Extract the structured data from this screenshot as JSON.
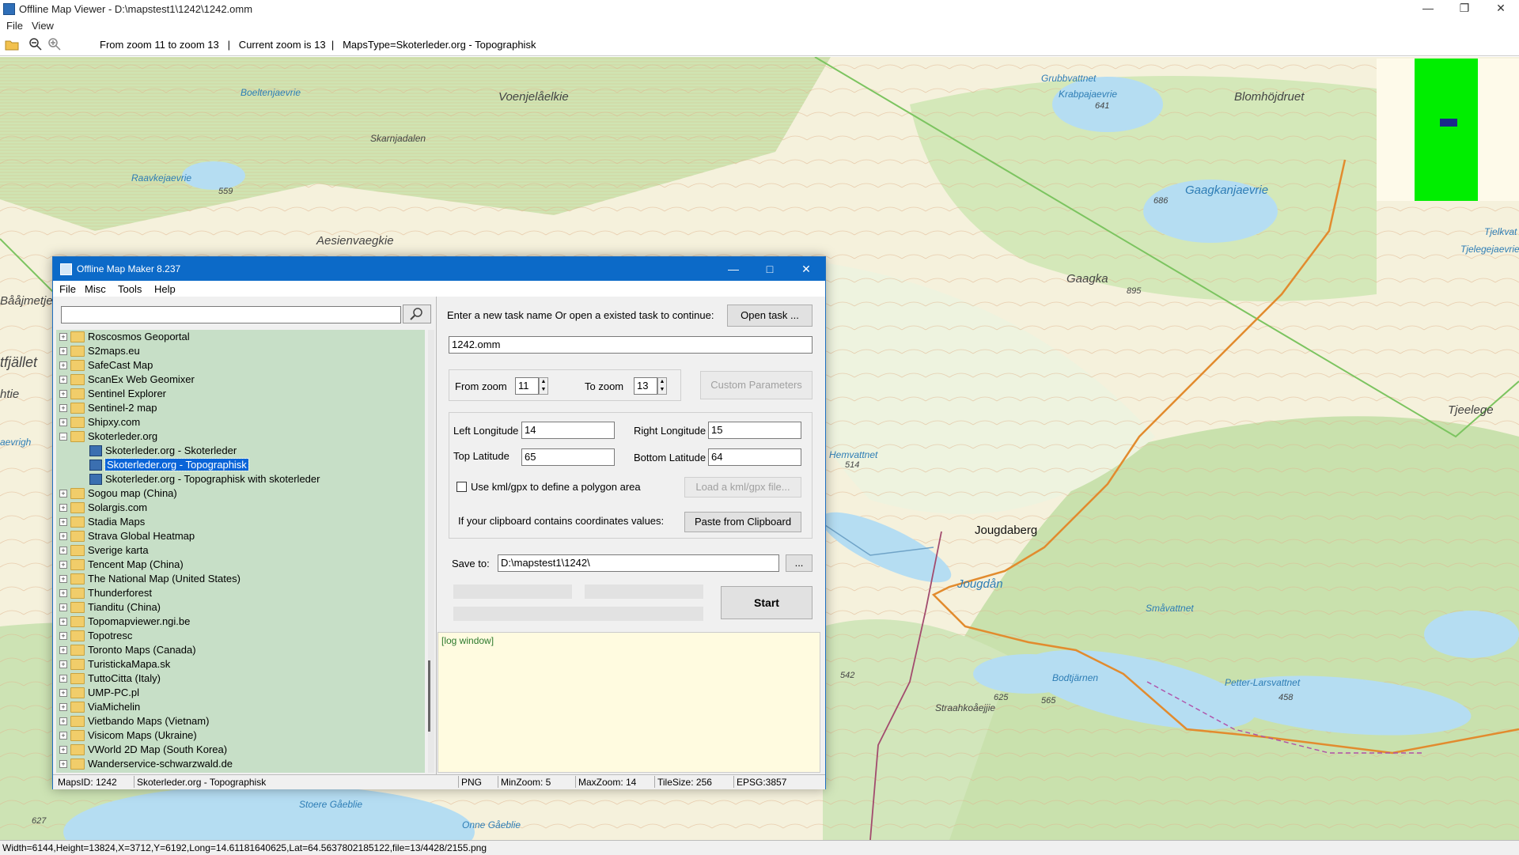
{
  "window": {
    "title": "Offline Map Viewer - D:\\mapstest1\\1242\\1242.omm",
    "menu": [
      "File",
      "View"
    ],
    "toolbar_info": "From zoom 11 to zoom 13   |   Current zoom is 13  |   MapsType=Skoterleder.org - Topographisk"
  },
  "map": {
    "labels": [
      "Voenjelåelkie",
      "Skarnjadalen",
      "Boeltenjaevrie",
      "Raavkejaevrie",
      "559",
      "Aesienvaegkie",
      "Bååjmetje",
      "tfjället",
      "htie",
      "aevrigh",
      "Grubbvattnet",
      "Krabpajaevrie",
      "641",
      "Blomhöjdruet",
      "Gaagkanjaevrie",
      "686",
      "Gaagka",
      "895",
      "Tjelkvat",
      "Tjelegejaevrie",
      "Tjeelege",
      "Hemvattnet",
      "514",
      "Jougdaberg",
      "Jougdån",
      "Småvattnet",
      "Petter-Larsvattnet",
      "458",
      "Bodtjärnen",
      "625",
      "565",
      "542",
      "Straahkoåejjie",
      "627",
      "Stoere Gåeblie",
      "Onne Gåeblie"
    ]
  },
  "statusbar": "Width=6144,Height=13824,X=3712,Y=6192,Long=14.61181640625,Lat=64.5637802185122,file=13/4428/2155.png",
  "dialog": {
    "title": "Offline Map Maker 8.237",
    "menu": [
      "File",
      "Misc",
      "Tools",
      "Help"
    ],
    "search_value": "",
    "tree": [
      {
        "label": "Roscosmos Geoportal",
        "type": "folder"
      },
      {
        "label": "S2maps.eu",
        "type": "folder"
      },
      {
        "label": "SafeCast Map",
        "type": "folder"
      },
      {
        "label": "ScanEx Web Geomixer",
        "type": "folder"
      },
      {
        "label": "Sentinel Explorer",
        "type": "folder"
      },
      {
        "label": "Sentinel-2 map",
        "type": "folder"
      },
      {
        "label": "Shipxy.com",
        "type": "folder"
      },
      {
        "label": "Skoterleder.org",
        "type": "folder-open"
      },
      {
        "label": "Skoterleder.org - Skoterleder",
        "type": "map"
      },
      {
        "label": "Skoterleder.org - Topographisk",
        "type": "map",
        "selected": true
      },
      {
        "label": "Skoterleder.org - Topographisk with skoterleder",
        "type": "map"
      },
      {
        "label": "Sogou map (China)",
        "type": "folder"
      },
      {
        "label": "Solargis.com",
        "type": "folder"
      },
      {
        "label": "Stadia Maps",
        "type": "folder"
      },
      {
        "label": "Strava Global Heatmap",
        "type": "folder"
      },
      {
        "label": "Sverige karta",
        "type": "folder"
      },
      {
        "label": "Tencent Map (China)",
        "type": "folder"
      },
      {
        "label": "The National Map (United States)",
        "type": "folder"
      },
      {
        "label": "Thunderforest",
        "type": "folder"
      },
      {
        "label": "Tianditu (China)",
        "type": "folder"
      },
      {
        "label": "Topomapviewer.ngi.be",
        "type": "folder"
      },
      {
        "label": "Topotresc",
        "type": "folder"
      },
      {
        "label": "Toronto Maps (Canada)",
        "type": "folder"
      },
      {
        "label": "TuristickaMapa.sk",
        "type": "folder"
      },
      {
        "label": "TuttoCitta (Italy)",
        "type": "folder"
      },
      {
        "label": "UMP-PC.pl",
        "type": "folder"
      },
      {
        "label": "ViaMichelin",
        "type": "folder"
      },
      {
        "label": "Vietbando Maps (Vietnam)",
        "type": "folder"
      },
      {
        "label": "Visicom Maps (Ukraine)",
        "type": "folder"
      },
      {
        "label": "VWorld 2D Map (South Korea)",
        "type": "folder"
      },
      {
        "label": "Wanderservice-schwarzwald.de",
        "type": "folder"
      }
    ],
    "task_prompt": "Enter a new task name Or open a existed task to continue:",
    "open_task": "Open task ...",
    "task_name": "1242.omm",
    "from_zoom_label": "From zoom",
    "from_zoom": "11",
    "to_zoom_label": "To zoom",
    "to_zoom": "13",
    "custom_params": "Custom Parameters",
    "left_lon_label": "Left Longitude",
    "left_lon": "14",
    "right_lon_label": "Right Longitude",
    "right_lon": "15",
    "top_lat_label": "Top Latitude",
    "top_lat": "65",
    "bottom_lat_label": "Bottom Latitude",
    "bottom_lat": "64",
    "kml_label": "Use kml/gpx to define a polygon area",
    "kml_button": "Load a kml/gpx file...",
    "clipboard_label": "If your clipboard contains coordinates values:",
    "paste_button": "Paste from Clipboard",
    "save_label": "Save to:",
    "save_path": "D:\\mapstest1\\1242\\",
    "browse_button": "...",
    "start_button": "Start",
    "log": "[log window]",
    "status": {
      "maps_id": "MapsID: 1242",
      "name": "Skoterleder.org - Topographisk",
      "format": "PNG",
      "min_zoom": "MinZoom: 5",
      "max_zoom": "MaxZoom: 14",
      "tile_size": "TileSize: 256",
      "epsg": "EPSG:3857"
    }
  }
}
